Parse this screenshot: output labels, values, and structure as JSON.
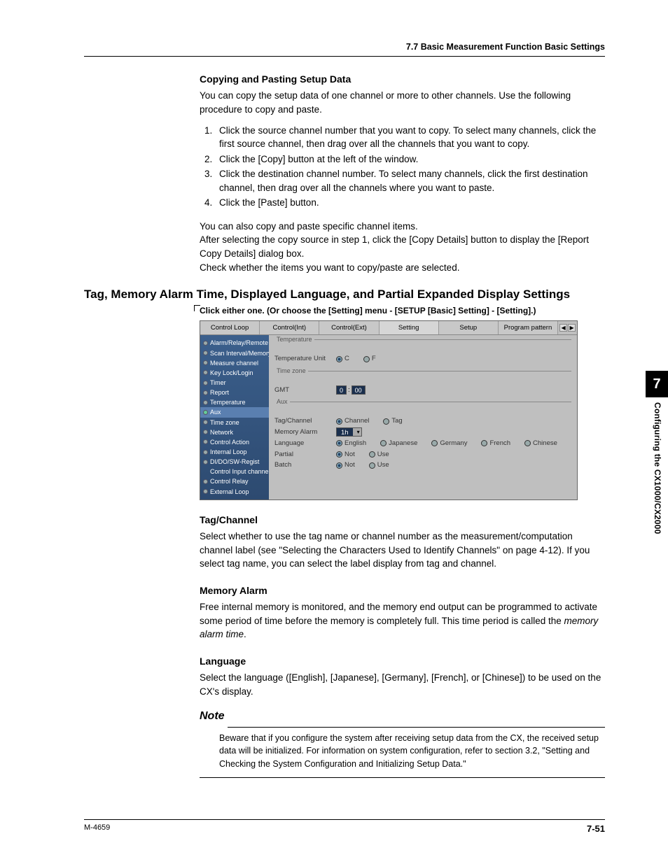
{
  "header": {
    "section": "7.7  Basic Measurement Function Basic Settings"
  },
  "copy_paste": {
    "title": "Copying and Pasting Setup Data",
    "intro": "You can copy the setup data of one channel or more to other channels.  Use the following procedure to copy and paste.",
    "steps": [
      "Click the source channel number that you want to copy.  To select many channels, click the first source channel, then drag over all the channels that you want to copy.",
      "Click the [Copy] button at the left of the window.",
      "Click the destination channel number.  To select many channels, click the first destination channel, then drag over all the channels where you want to paste.",
      "Click the [Paste] button."
    ],
    "extra1": "You can also copy and paste specific channel items.",
    "extra2": "After selecting the copy source in step 1, click the [Copy Details] button to display the [Report Copy Details] dialog box.",
    "extra3": "Check whether the items you want to copy/paste are selected."
  },
  "main_heading": "Tag, Memory Alarm Time, Displayed Language, and Partial Expanded Display Settings",
  "callout": "Click either one. (Or choose the [Setting] menu - [SETUP [Basic] Setting] - [Setting].)",
  "ui": {
    "tabs": [
      "Control Loop",
      "Control(Int)",
      "Control(Ext)",
      "Setting",
      "Setup",
      "Program pattern"
    ],
    "selected_tab_index": 3,
    "sidebar": [
      "Alarm/Relay/Remote",
      "Scan Interval/Memory",
      "Measure channel",
      "Key Lock/Login",
      "Timer",
      "Report",
      "Temperature",
      "Aux",
      "Time zone",
      "Network",
      "Control Action",
      "Internal Loop",
      "DI/DO/SW-Regist",
      "Control Input channel",
      "Control Relay",
      "External Loop"
    ],
    "sidebar_selected": 7,
    "groups": {
      "temperature": {
        "title": "Temperature",
        "label": "Temperature Unit",
        "opts": [
          "C",
          "F"
        ],
        "sel": 0
      },
      "timezone": {
        "title": "Time zone",
        "label": "GMT",
        "hh": "0",
        "mm": "00"
      },
      "aux": {
        "title": "Aux",
        "rows": [
          {
            "label": "Tag/Channel",
            "opts": [
              "Channel",
              "Tag"
            ],
            "sel": 0
          },
          {
            "label": "Memory Alarm",
            "combo": "1h"
          },
          {
            "label": "Language",
            "opts": [
              "English",
              "Japanese",
              "Germany",
              "French",
              "Chinese"
            ],
            "sel": 0
          },
          {
            "label": "Partial",
            "opts": [
              "Not",
              "Use"
            ],
            "sel": 0
          },
          {
            "label": "Batch",
            "opts": [
              "Not",
              "Use"
            ],
            "sel": 0
          }
        ]
      }
    }
  },
  "sections": {
    "tag": {
      "title": "Tag/Channel",
      "body": "Select whether to use the tag name or channel number as the measurement/computation channel label (see \"Selecting the Characters Used to Identify Channels\" on page 4-12). If you select tag name, you can select the label display from tag and channel."
    },
    "mem": {
      "title": "Memory Alarm",
      "body1": "Free internal memory is monitored, and the memory end output can be programmed to activate some period of time before the memory is completely full.  This time period is called the ",
      "body2": "memory alarm time",
      "body3": "."
    },
    "lang": {
      "title": "Language",
      "body": "Select the language ([English], [Japanese], [Germany], [French], or [Chinese]) to be used on the CX's display."
    }
  },
  "note": {
    "title": "Note",
    "body": "Beware that if you configure the system after receiving setup data from the CX, the received setup data will be initialized. For information on system configuration, refer to section 3.2, \"Setting and Checking the System Configuration and Initializing Setup Data.\""
  },
  "thumb": {
    "num": "7",
    "label": "Configuring the CX1000/CX2000"
  },
  "footer": {
    "left": "M-4659",
    "right": "7-51"
  }
}
